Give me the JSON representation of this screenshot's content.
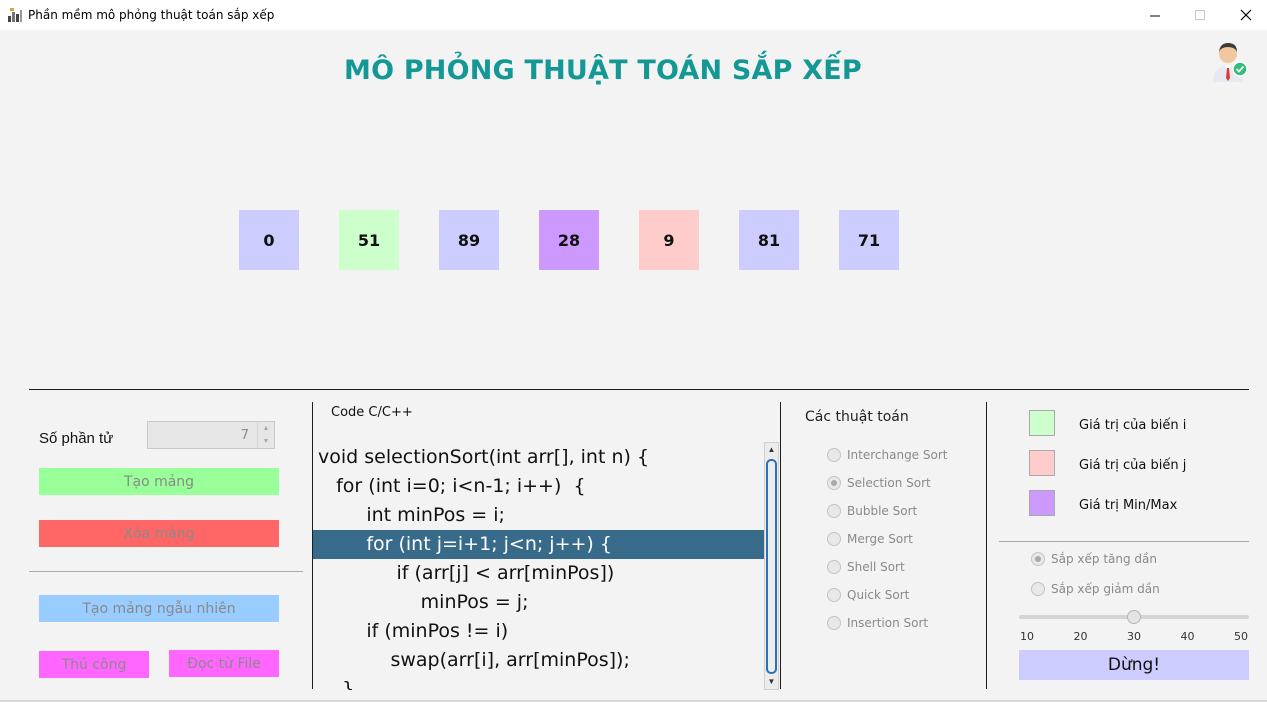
{
  "window": {
    "title": "Phần mềm mô phỏng thuật toán sắp xếp",
    "minimize_icon": "minimize-icon",
    "maximize_icon": "maximize-icon",
    "close_icon": "close-icon"
  },
  "header": {
    "title": "MÔ PHỎNG THUẬT TOÁN SẮP XẾP",
    "title_color": "#149896",
    "avatar_icon": "user-avatar-icon"
  },
  "array": {
    "items": [
      {
        "value": "0",
        "color": "#ccccff"
      },
      {
        "value": "51",
        "color": "#ccffcc"
      },
      {
        "value": "89",
        "color": "#ccccff"
      },
      {
        "value": "28",
        "color": "#cc99ff"
      },
      {
        "value": "9",
        "color": "#ffcccc"
      },
      {
        "value": "81",
        "color": "#ccccff"
      },
      {
        "value": "71",
        "color": "#ccccff"
      }
    ]
  },
  "controls": {
    "count_label": "Số phần tử",
    "count_value": "7",
    "create_array": "Tạo mảng",
    "delete_array": "Xóa mảng",
    "random_array": "Tạo mảng ngẫu nhiên",
    "manual": "Thủ công",
    "read_file": "Đọc từ File",
    "create_color": "#99ff99",
    "delete_color": "#ff6666",
    "random_color": "#99ccff",
    "manual_color": "#ff66ff"
  },
  "code": {
    "title": "Code C/C++",
    "lines": [
      "void selectionSort(int arr[], int n) {",
      "   for (int i=0; i<n-1; i++)  {",
      "        int minPos = i;",
      "        for (int j=i+1; j<n; j++) {",
      "             if (arr[j] < arr[minPos])",
      "                 minPos = j;",
      "        if (minPos != i)",
      "            swap(arr[i], arr[minPos]);",
      "    }"
    ],
    "highlight_color": "#386b8a"
  },
  "algorithms": {
    "title": "Các thuật toán",
    "items": [
      {
        "label": "Interchange Sort",
        "selected": false
      },
      {
        "label": "Selection Sort",
        "selected": true
      },
      {
        "label": "Bubble Sort",
        "selected": false
      },
      {
        "label": "Merge Sort",
        "selected": false
      },
      {
        "label": "Shell Sort",
        "selected": false
      },
      {
        "label": "Quick Sort",
        "selected": false
      },
      {
        "label": "Insertion Sort",
        "selected": false
      }
    ]
  },
  "legend": {
    "items": [
      {
        "label": "Giá trị của biến i",
        "color": "#ccffcc"
      },
      {
        "label": "Giá trị của biến j",
        "color": "#ffcccc"
      },
      {
        "label": "Giá trị Min/Max",
        "color": "#cc99ff"
      }
    ]
  },
  "sort_order": {
    "ascending": "Sắp xếp tăng dần",
    "descending": "Sắp xếp giảm dần",
    "ascending_selected": true
  },
  "speed": {
    "ticks": [
      "10",
      "20",
      "30",
      "40",
      "50"
    ],
    "value": 30,
    "min": 10,
    "max": 50
  },
  "stop_button": "Dừng!"
}
